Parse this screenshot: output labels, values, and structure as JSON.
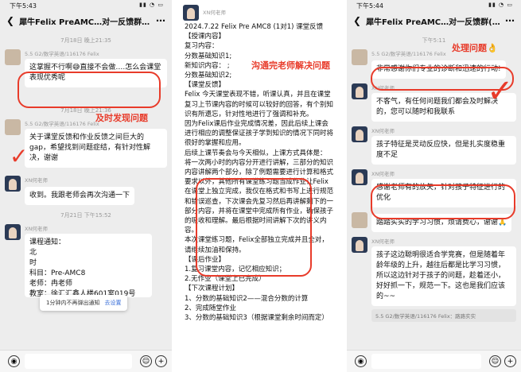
{
  "left": {
    "status_time": "下午5:43",
    "title": "犀牛Felix PreAMC…对一反馈群(11)",
    "time1": "7月18日 晚上21:35",
    "sender1": "5.5 G2/数学英语/116176 Felix",
    "msg1": "这掌握不行啊😅直接不会做….怎么会课堂表现优秀呢",
    "time2": "7月18日 晚上21:36",
    "sender2": "5.5 G2/数学英语/116176 Felix",
    "msg2": "关于课堂反馈和作业反馈之间巨大的gap，希望找到问题症结，有针对性解决，谢谢",
    "sender3": "XN何老师",
    "msg3": "收到。我跟老师会再次沟通一下",
    "time3": "7月21日 下午15:52",
    "sender4": "XN何老师",
    "msg4_lines": [
      "课程通知：",
      "北",
      "时",
      "科目：Pre-AMC8",
      "老师：冉老师",
      "教室：徐汇汇鑫人楼601室019号"
    ],
    "toast_text": "1分钟内不再弹出通知",
    "toast_link": "去设置",
    "anno1": "及时发现问题"
  },
  "middle": {
    "sender": "XN何老师",
    "anno": "沟通完老师解决问题",
    "lines": [
      "2024.7.22  Felix Pre AMC8 (1对1) 课堂反馈",
      "【授课内容】",
      "复习内容：",
      "        分数基础知识1;",
      "新知识内容：                ;",
      "        分数基础知识2;",
      "【课堂反馈】",
      "Felix 今天课堂表现不错，听课认真，并且在课堂复习上节课内容的时候可以较好的回答，有个别知识有所遗忘，针对性地进行了强调和补充。",
      "因为Felix课后作业完成情况差，因此后续上课会进行相应的调整保证孩子学到知识的情况下同时将很好的掌握和应用。",
      "后续上课节奏会与今天相似，上课方式具体是：",
      "将一次两小时的内容分开进行讲解，三部分的知识内容讲解两个部分，除了例题需要进行计算和格式要求以外，其他所有课堂练习题当成作业让Felix在课堂上独立完成，我仅在格式和书写上进行规范和错误巡查，下次课会先复习然后再讲解剩下的一部分内容，并将在课堂中完成所有作业，确保孩子的吸收和理解。最后根据时间讲解下次的讲义内容。",
      "本次课堂练习题，Felix全部独立完成并且全对，请继续加油和保持。",
      "【课后作业】",
      "1.复习课堂内容，记忆相应知识；",
      "2.无作业（课堂上已完成）",
      "【下次课程计划】",
      "1、分数的基础知识2——混合分数的计算",
      "2、完成随堂作业",
      "3、分数的基础知识3（根据课堂剩余时间而定）"
    ]
  },
  "right": {
    "status_time": "下午5:44",
    "title": "犀牛Felix PreAMC…对一反馈群(11)",
    "time1": "下午5:11",
    "sender1": "5.5 G2/数学英语/116176 Felix",
    "msg1": "非常感谢你们专业的诊断和迅速的行动!",
    "sender2": "XN何老师",
    "msg2": "不客气，有任何问题我们都会及时解决的，您可以随时和我联系",
    "sender3": "XN何老师",
    "msg3": "孩子特征是灵动反应快，但是扎实度稳重度不足",
    "sender4": "XN何老师",
    "msg4": "感谢老师有的放矢，针对孩子特征进行的优化",
    "msg5": "踏踏实实的学习习惯，烦请费心，谢谢🙏",
    "sender6": "XN何老师",
    "msg6": "孩子这边聪明很适合学竞赛，但是随着年龄年级的上升，越往后都是比学习习惯，所以这边针对于孩子的问题，趁着还小，好好抓一下，规范一下。这也是我们应该的~~",
    "quote": "5.5 G2/数学英语/116176 Felix：路路实实",
    "anno": "处理问题👌"
  }
}
